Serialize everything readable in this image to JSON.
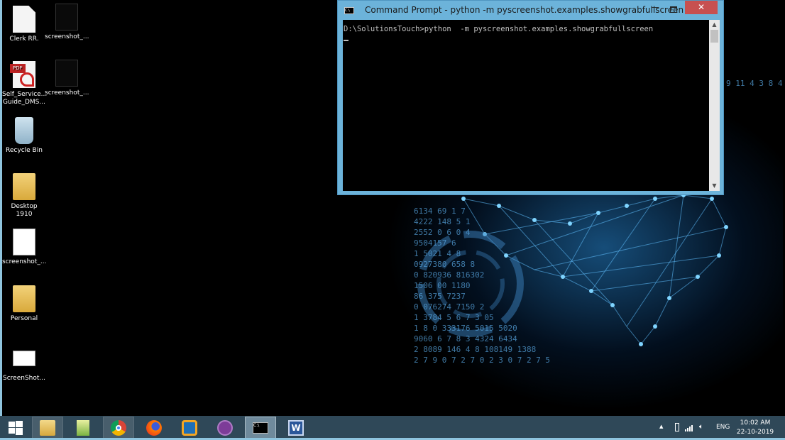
{
  "desktop": {
    "icons": [
      {
        "label": "Clerk RR.",
        "type": "document"
      },
      {
        "label": "screenshot_...",
        "type": "image"
      },
      {
        "label": "Self_Service... Guide_DMS...",
        "type": "pdf"
      },
      {
        "label": "screenshot_...",
        "type": "image"
      },
      {
        "label": "Recycle Bin",
        "type": "recycle-bin"
      },
      {
        "label": "Desktop 1910",
        "type": "folder"
      },
      {
        "label": "screenshot_...",
        "type": "image"
      },
      {
        "label": "Personal",
        "type": "folder"
      },
      {
        "label": "ScreenShot...",
        "type": "app"
      }
    ],
    "wallpaper_digits": [
      "9 11 4 3 8 4",
      "6134 69 1 7",
      "4222 148 5 1",
      "2552 0 6 0 4",
      "9504157 6",
      "1 5021 4 8",
      "0927380 658 8",
      "0 820936 816302",
      "1506 00 1180",
      "86 375 7237",
      "0 076274 7150 2",
      "1 3784 5 6 7 3 05",
      "1 8 0 333176 5015 5020",
      "9060 6 7 8 3 4324 6434",
      "2 8089 146 4 8 108149 1388",
      "2 7 9 0 7 2 7 0 2 3 0 7 2 7 5"
    ]
  },
  "window": {
    "title": "Command Prompt - python   -m pyscreenshot.examples.showgrabfullscreen",
    "minimize": "—",
    "close": "✕",
    "console_line": "D:\\SolutionsTouch>python  -m pyscreenshot.examples.showgrabfullscreen",
    "icon_text": "C:\\",
    "frame_color": "#6cb3da"
  },
  "taskbar": {
    "color": "#2f4858",
    "apps": [
      {
        "name": "file-explorer",
        "state": "running"
      },
      {
        "name": "notepad-plus",
        "state": "idle"
      },
      {
        "name": "chrome",
        "state": "running"
      },
      {
        "name": "firefox",
        "state": "idle"
      },
      {
        "name": "virtualbox",
        "state": "idle"
      },
      {
        "name": "tor-browser",
        "state": "idle"
      },
      {
        "name": "command-prompt",
        "state": "active"
      },
      {
        "name": "word",
        "state": "idle"
      }
    ],
    "tray": {
      "chevron": "▲",
      "language": "ENG",
      "time": "10:02 AM",
      "date": "22-10-2019"
    }
  }
}
